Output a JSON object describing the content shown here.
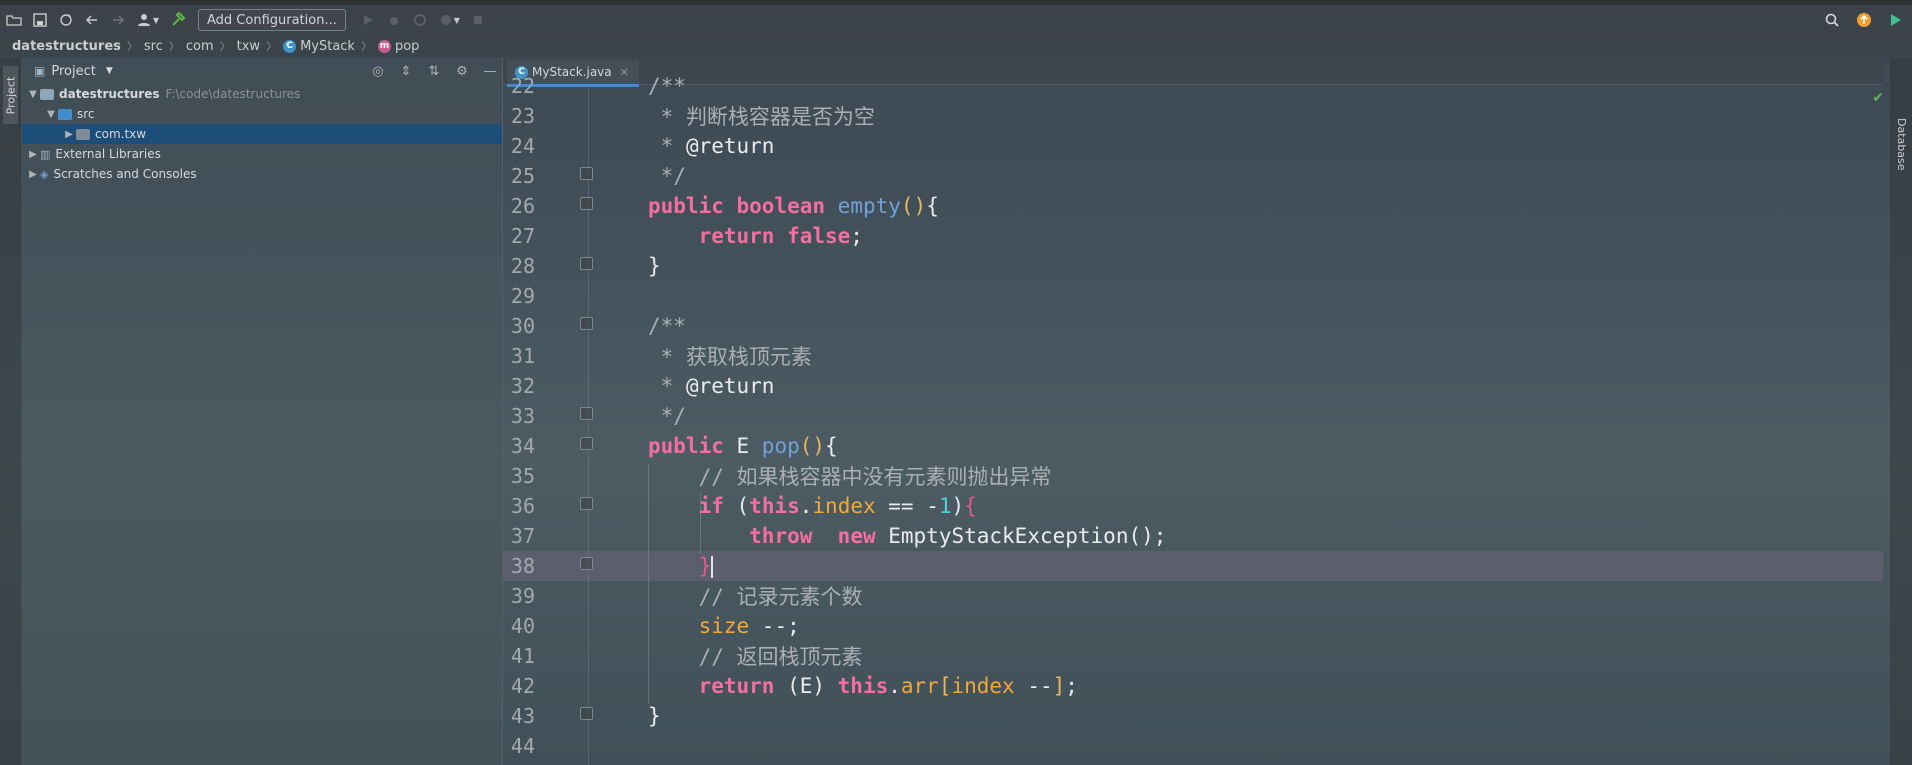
{
  "toolbar": {
    "config_label": "Add Configuration...",
    "icons": [
      "open-icon",
      "save-icon",
      "sync-icon",
      "back-icon",
      "forward-icon",
      "user-icon",
      "build-hammer-icon",
      "run-icon",
      "debug-icon",
      "coverage-icon",
      "profile-icon",
      "stop-icon"
    ]
  },
  "breadcrumb": {
    "items": [
      "datestructures",
      "src",
      "com",
      "txw",
      "MyStack",
      "pop"
    ]
  },
  "left_stripe": {
    "project_label": "Project"
  },
  "project_panel": {
    "title": "Project",
    "tree": [
      {
        "label": "datestructures",
        "extra": "F:\\code\\datestructures"
      },
      {
        "label": "src",
        "extra": ""
      },
      {
        "label": "com.txw",
        "extra": ""
      },
      {
        "label": "External Libraries",
        "extra": ""
      },
      {
        "label": "Scratches and Consoles",
        "extra": ""
      }
    ]
  },
  "editor": {
    "tab_label": "MyStack.java",
    "line_numbers": [
      "22",
      "23",
      "24",
      "25",
      "26",
      "27",
      "28",
      "29",
      "30",
      "31",
      "32",
      "33",
      "34",
      "35",
      "36",
      "37",
      "38",
      "39",
      "40",
      "41",
      "42",
      "43",
      "44"
    ],
    "comment_empty": "判断栈容器是否为空",
    "comment_pop": "获取栈顶元素",
    "comment_throw": "// 如果栈容器中没有元素则抛出异常",
    "comment_count": "// 记录元素个数",
    "comment_return": "// 返回栈顶元素",
    "current_line": "38"
  },
  "right_stripe": {
    "database_label": "Database"
  },
  "colors": {
    "keyword": "#f46ea0",
    "function": "#6fa2da",
    "field": "#f0a93a",
    "number": "#4ad4d8",
    "selection": "#1d4e7a"
  }
}
